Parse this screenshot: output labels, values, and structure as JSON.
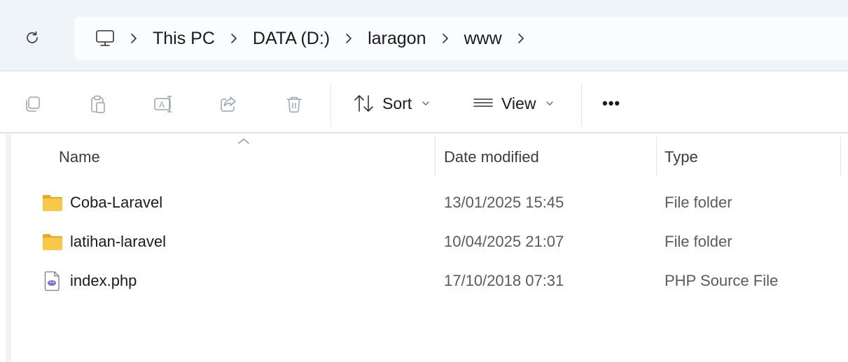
{
  "address_bar": {
    "breadcrumbs": [
      {
        "label": "This PC"
      },
      {
        "label": "DATA (D:)"
      },
      {
        "label": "laragon"
      },
      {
        "label": "www"
      }
    ]
  },
  "command_bar": {
    "sort_label": "Sort",
    "view_label": "View",
    "more_label": "•••"
  },
  "columns": {
    "name": "Name",
    "date_modified": "Date modified",
    "type": "Type"
  },
  "files": [
    {
      "name": "Coba-Laravel",
      "date_modified": "13/01/2025 15:45",
      "type": "File folder",
      "icon": "folder-icon"
    },
    {
      "name": "latihan-laravel",
      "date_modified": "10/04/2025 21:07",
      "type": "File folder",
      "icon": "folder-icon"
    },
    {
      "name": "index.php",
      "date_modified": "17/10/2018 07:31",
      "type": "PHP Source File",
      "icon": "php-file-icon"
    }
  ],
  "colors": {
    "address_strip_bg": "#eff4f9",
    "folder_yellow": "#f8c84a",
    "php_purple": "#8a6fc4",
    "icon_gray": "#9aa3ad"
  }
}
